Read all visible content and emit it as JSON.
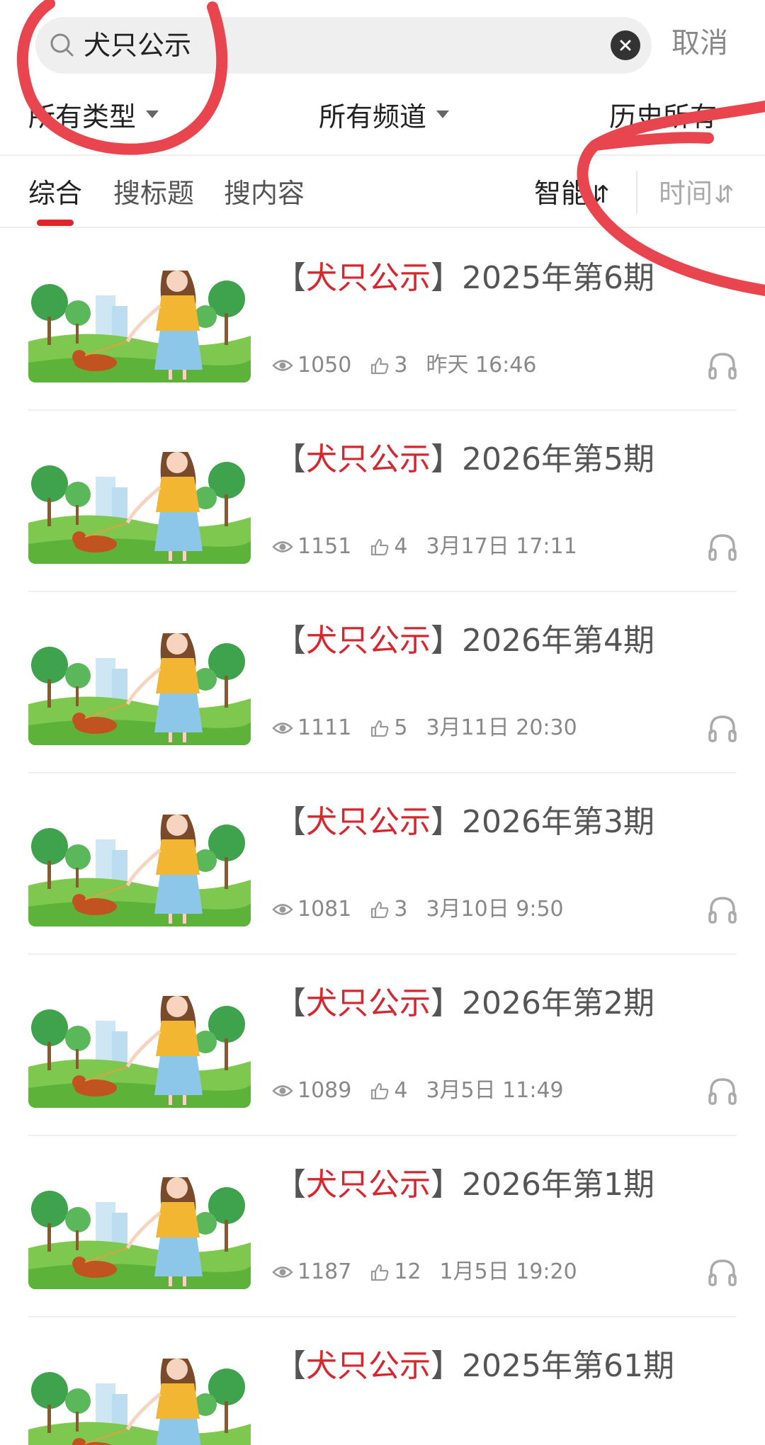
{
  "search": {
    "query": "犬只公示",
    "cancel_label": "取消"
  },
  "filters": [
    {
      "label": "所有类型"
    },
    {
      "label": "所有频道"
    },
    {
      "label": "历史所有"
    }
  ],
  "tabs": [
    {
      "label": "综合"
    },
    {
      "label": "搜标题"
    },
    {
      "label": "搜内容"
    }
  ],
  "sort": {
    "smart_label": "智能",
    "time_label": "时间"
  },
  "colors": {
    "accent": "#e0232b",
    "keyword": "#d8262e",
    "annotation": "#e8454e"
  },
  "items": [
    {
      "keyword": "犬只公示",
      "suffix": "2025年第6期",
      "views": "1050",
      "likes": "3",
      "time": "昨天 16:46"
    },
    {
      "keyword": "犬只公示",
      "suffix": "2026年第5期",
      "views": "1151",
      "likes": "4",
      "time": "3月17日 17:11"
    },
    {
      "keyword": "犬只公示",
      "suffix": "2026年第4期",
      "views": "1111",
      "likes": "5",
      "time": "3月11日 20:30"
    },
    {
      "keyword": "犬只公示",
      "suffix": "2026年第3期",
      "views": "1081",
      "likes": "3",
      "time": "3月10日 9:50"
    },
    {
      "keyword": "犬只公示",
      "suffix": "2026年第2期",
      "views": "1089",
      "likes": "4",
      "time": "3月5日 11:49"
    },
    {
      "keyword": "犬只公示",
      "suffix": "2026年第1期",
      "views": "1187",
      "likes": "12",
      "time": "1月5日 19:20"
    },
    {
      "keyword": "犬只公示",
      "suffix": "2025年第61期",
      "views": "",
      "likes": "",
      "time": ""
    }
  ]
}
